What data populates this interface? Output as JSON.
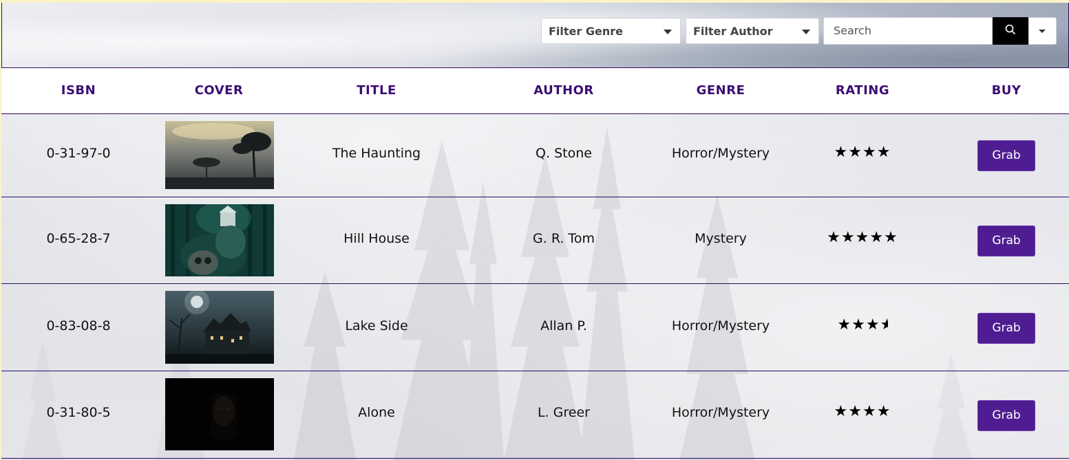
{
  "filters": {
    "genre_label": "Filter Genre",
    "author_label": "Filter Author",
    "search_placeholder": "Search"
  },
  "table": {
    "columns": [
      "ISBN",
      "COVER",
      "TITLE",
      "AUTHOR",
      "GENRE",
      "RATING",
      "BUY"
    ],
    "rows": [
      {
        "isbn": "0-31-97-0",
        "title": "The Haunting",
        "author": "Q. Stone",
        "genre": "Horror/Mystery",
        "rating": 4,
        "buy_label": "Grab"
      },
      {
        "isbn": "0-65-28-7",
        "title": "Hill House",
        "author": "G. R. Tom",
        "genre": "Mystery",
        "rating": 5,
        "buy_label": "Grab"
      },
      {
        "isbn": "0-83-08-8",
        "title": "Lake Side",
        "author": "Allan P.",
        "genre": "Horror/Mystery",
        "rating": 3.5,
        "buy_label": "Grab"
      },
      {
        "isbn": "0-31-80-5",
        "title": "Alone",
        "author": "L. Greer",
        "genre": "Horror/Mystery",
        "rating": 4,
        "buy_label": "Grab"
      }
    ]
  },
  "colors": {
    "accent": "#3b0e73",
    "button": "#4f1d91",
    "border": "#2d0a5f",
    "search_button": "#000000"
  },
  "icons": {
    "search_button": "search-icon",
    "dropdown": "chevron-down-icon",
    "rating": "star-icon"
  }
}
